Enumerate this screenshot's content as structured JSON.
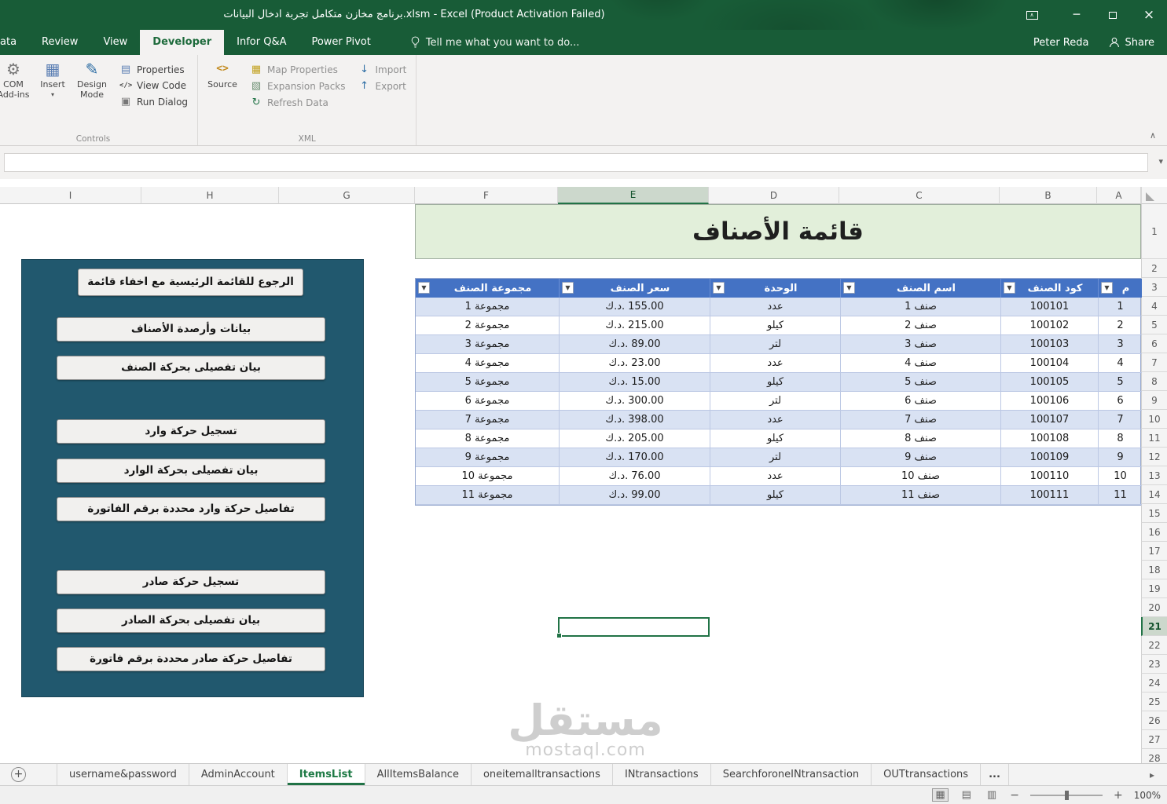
{
  "titlebar": {
    "title": "برنامج مخازن متكامل تجربة ادخال البيانات.xlsm - Excel (Product Activation Failed)"
  },
  "ribbon_tabs": {
    "items": [
      {
        "label": "Data",
        "active": false
      },
      {
        "label": "Review",
        "active": false
      },
      {
        "label": "View",
        "active": false
      },
      {
        "label": "Developer",
        "active": true
      },
      {
        "label": "Infor Q&A",
        "active": false
      },
      {
        "label": "Power Pivot",
        "active": false
      }
    ],
    "tell_me": "Tell me what you want to do...",
    "user_name": "Peter Reda",
    "share_label": "Share"
  },
  "ribbon": {
    "com_addins_label": "COM Add-ins",
    "insert_label": "Insert",
    "design_mode_label": "Design Mode",
    "properties_label": "Properties",
    "view_code_label": "View Code",
    "run_dialog_label": "Run Dialog",
    "controls_group_label": "Controls",
    "source_label": "Source",
    "map_properties_label": "Map Properties",
    "expansion_packs_label": "Expansion Packs",
    "refresh_data_label": "Refresh Data",
    "import_label": "Import",
    "export_label": "Export",
    "xml_group_label": "XML"
  },
  "grid": {
    "column_headers": [
      "I",
      "H",
      "G",
      "F",
      "E",
      "D",
      "C",
      "B",
      "A"
    ],
    "selected_column": "E",
    "row_count": 28,
    "selected_row": 21,
    "sheet_title": "قائمة الأصناف"
  },
  "items_table": {
    "headers": [
      "مجموعة الصنف",
      "سعر الصنف",
      "الوحدة",
      "اسم الصنف",
      "كود الصنف",
      "م"
    ],
    "rows": [
      {
        "group": "مجموعة 1",
        "currency": "د.ك.",
        "price": "155.00",
        "unit": "عدد",
        "name": "صنف 1",
        "code": "100101",
        "sn": "1"
      },
      {
        "group": "مجموعة 2",
        "currency": "د.ك.",
        "price": "215.00",
        "unit": "كيلو",
        "name": "صنف 2",
        "code": "100102",
        "sn": "2"
      },
      {
        "group": "مجموعة 3",
        "currency": "د.ك.",
        "price": "89.00",
        "unit": "لتر",
        "name": "صنف 3",
        "code": "100103",
        "sn": "3"
      },
      {
        "group": "مجموعة 4",
        "currency": "د.ك.",
        "price": "23.00",
        "unit": "عدد",
        "name": "صنف 4",
        "code": "100104",
        "sn": "4"
      },
      {
        "group": "مجموعة 5",
        "currency": "د.ك.",
        "price": "15.00",
        "unit": "كيلو",
        "name": "صنف 5",
        "code": "100105",
        "sn": "5"
      },
      {
        "group": "مجموعة 6",
        "currency": "د.ك.",
        "price": "300.00",
        "unit": "لتر",
        "name": "صنف 6",
        "code": "100106",
        "sn": "6"
      },
      {
        "group": "مجموعة 7",
        "currency": "د.ك.",
        "price": "398.00",
        "unit": "عدد",
        "name": "صنف 7",
        "code": "100107",
        "sn": "7"
      },
      {
        "group": "مجموعة 8",
        "currency": "د.ك.",
        "price": "205.00",
        "unit": "كيلو",
        "name": "صنف 8",
        "code": "100108",
        "sn": "8"
      },
      {
        "group": "مجموعة 9",
        "currency": "د.ك.",
        "price": "170.00",
        "unit": "لتر",
        "name": "صنف 9",
        "code": "100109",
        "sn": "9"
      },
      {
        "group": "مجموعة 10",
        "currency": "د.ك.",
        "price": "76.00",
        "unit": "عدد",
        "name": "صنف 10",
        "code": "100110",
        "sn": "10"
      },
      {
        "group": "مجموعة 11",
        "currency": "د.ك.",
        "price": "99.00",
        "unit": "كيلو",
        "name": "صنف 11",
        "code": "100111",
        "sn": "11"
      }
    ]
  },
  "panel": {
    "buttons": [
      "الرجوع للقائمة الرئيسية مع اخفاء قائمة",
      "بيانات وأرصدة الأصناف",
      "بيان تفصيلى بحركة الصنف",
      "تسجيل حركة وارد",
      "بيان تفصيلى بحركة الوارد",
      "تفاصيل حركة وارد محددة برقم الفاتورة",
      "تسجيل حركة صادر",
      "بيان تفصيلى بحركة الصادر",
      "تفاصيل حركة صادر محددة برقم فاتورة"
    ]
  },
  "sheet_tabs": {
    "items": [
      {
        "label": "username&password",
        "active": false
      },
      {
        "label": "AdminAccount",
        "active": false
      },
      {
        "label": "ItemsList",
        "active": true
      },
      {
        "label": "AllItemsBalance",
        "active": false
      },
      {
        "label": "oneitemalltransactions",
        "active": false
      },
      {
        "label": "INtransactions",
        "active": false
      },
      {
        "label": "SearchforoneINtransaction",
        "active": false
      },
      {
        "label": "OUTtransactions",
        "active": false
      }
    ],
    "overflow_label": "..."
  },
  "status_bar": {
    "zoom_level": "100%"
  },
  "watermark": {
    "line1": "مستقل",
    "line2": "mostaql.com"
  },
  "colors": {
    "titlebar_green": "#185c37",
    "accent_green": "#217346",
    "table_header_blue": "#4472c4",
    "band_blue": "#d9e2f3",
    "title_fill_green": "#e2efda",
    "panel_blue": "#21586e"
  }
}
